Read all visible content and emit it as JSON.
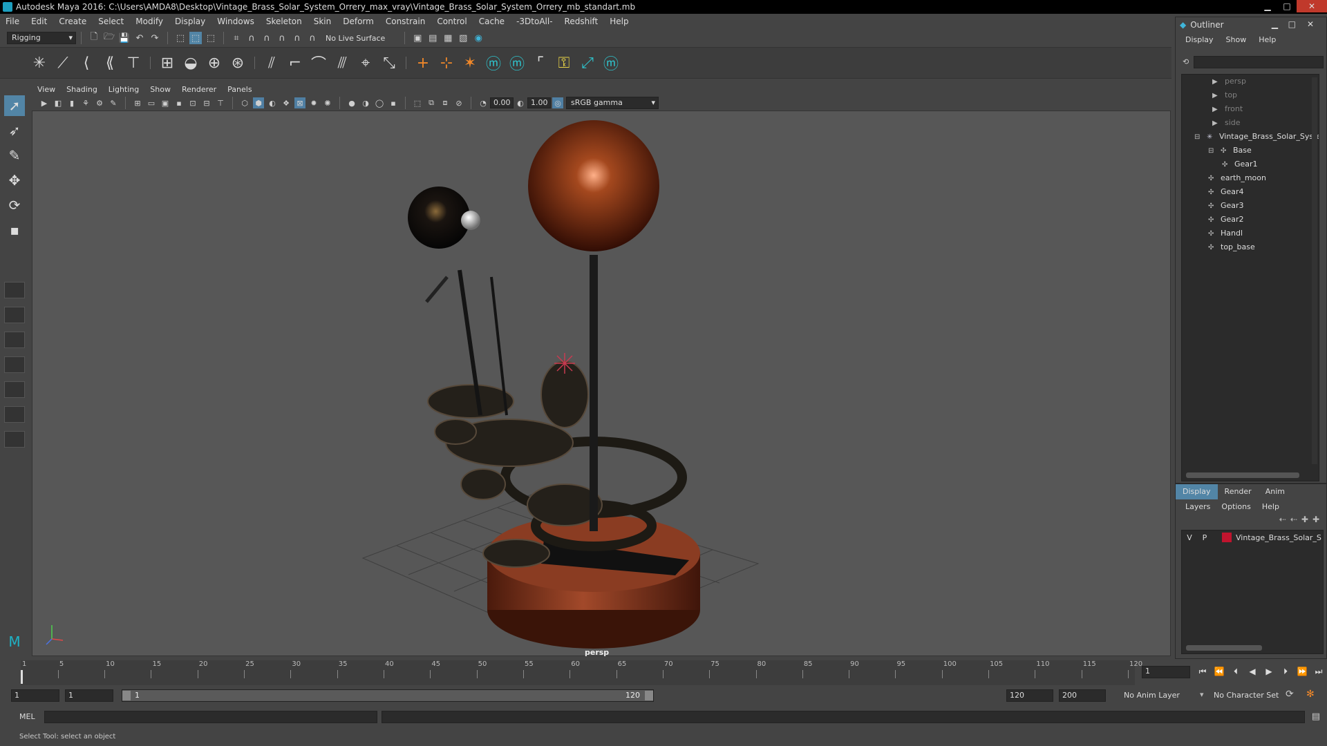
{
  "window": {
    "title": "Autodesk Maya 2016: C:\\Users\\AMDA8\\Desktop\\Vintage_Brass_Solar_System_Orrery_max_vray\\Vintage_Brass_Solar_System_Orrery_mb_standart.mb",
    "min": "▁",
    "max": "□",
    "close": "✕"
  },
  "menubar": [
    "File",
    "Edit",
    "Create",
    "Select",
    "Modify",
    "Display",
    "Windows",
    "Skeleton",
    "Skin",
    "Deform",
    "Constrain",
    "Control",
    "Cache",
    "-3DtoAll-",
    "Redshift",
    "Help"
  ],
  "statusline": {
    "menuset": "Rigging",
    "live_surface": "No Live Surface"
  },
  "viewport": {
    "menus": [
      "View",
      "Shading",
      "Lighting",
      "Show",
      "Renderer",
      "Panels"
    ],
    "gamma_value": "0.00",
    "exposure_value": "1.00",
    "color_space": "sRGB gamma",
    "camera_label": "persp"
  },
  "outliner": {
    "title": "Outliner",
    "menus": [
      "Display",
      "Show",
      "Help"
    ],
    "nodes": [
      {
        "label": "persp",
        "dim": true
      },
      {
        "label": "top",
        "dim": true
      },
      {
        "label": "front",
        "dim": true
      },
      {
        "label": "side",
        "dim": true
      },
      {
        "label": "Vintage_Brass_Solar_System",
        "dim": false
      },
      {
        "label": "Base",
        "dim": false
      },
      {
        "label": "Gear1",
        "dim": false
      },
      {
        "label": "earth_moon",
        "dim": false
      },
      {
        "label": "Gear4",
        "dim": false
      },
      {
        "label": "Gear3",
        "dim": false
      },
      {
        "label": "Gear2",
        "dim": false
      },
      {
        "label": "Handl",
        "dim": false
      },
      {
        "label": "top_base",
        "dim": false
      }
    ]
  },
  "layer_editor": {
    "tabs": [
      "Display",
      "Render",
      "Anim"
    ],
    "menus": [
      "Layers",
      "Options",
      "Help"
    ],
    "layer": {
      "v": "V",
      "p": "P",
      "name": "Vintage_Brass_Solar_S",
      "color": "#c0142e"
    }
  },
  "timeline": {
    "ticks": [
      "1",
      "5",
      "10",
      "15",
      "20",
      "25",
      "30",
      "35",
      "40",
      "45",
      "50",
      "55",
      "60",
      "65",
      "70",
      "75",
      "80",
      "85",
      "90",
      "95",
      "100",
      "105",
      "110",
      "115",
      "120"
    ],
    "current_frame": "1"
  },
  "range": {
    "start": "1",
    "anim_start": "1",
    "range_start_label": "1",
    "range_end_label": "120",
    "anim_end": "120",
    "end": "200",
    "anim_layer": "No Anim Layer",
    "char_set": "No Character Set"
  },
  "cmdline": {
    "label": "MEL"
  },
  "helpline": {
    "text": "Select Tool: select an object"
  }
}
